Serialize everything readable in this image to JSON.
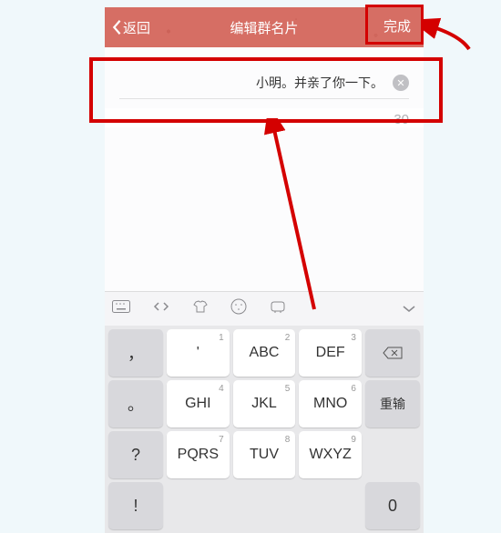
{
  "header": {
    "back": "返回",
    "title": "编辑群名片",
    "done": "完成"
  },
  "input": {
    "value": "小明。并亲了你一下。",
    "counter": "30"
  },
  "keys": {
    "r1c1": "，",
    "r1c2": "'",
    "r1c3": "ABC",
    "r1c4": "DEF",
    "r2c1": "。",
    "r2c2": "GHI",
    "r2c3": "JKL",
    "r2c4": "MNO",
    "r2c5": "重输",
    "r3c1": "?",
    "r3c2": "PQRS",
    "r3c3": "TUV",
    "r3c4": "WXYZ",
    "r4c1": "!",
    "r4c5": "0",
    "n1": "1",
    "n2": "2",
    "n3": "3",
    "n4": "4",
    "n5": "5",
    "n6": "6",
    "n7": "7",
    "n8": "8",
    "n9": "9"
  }
}
